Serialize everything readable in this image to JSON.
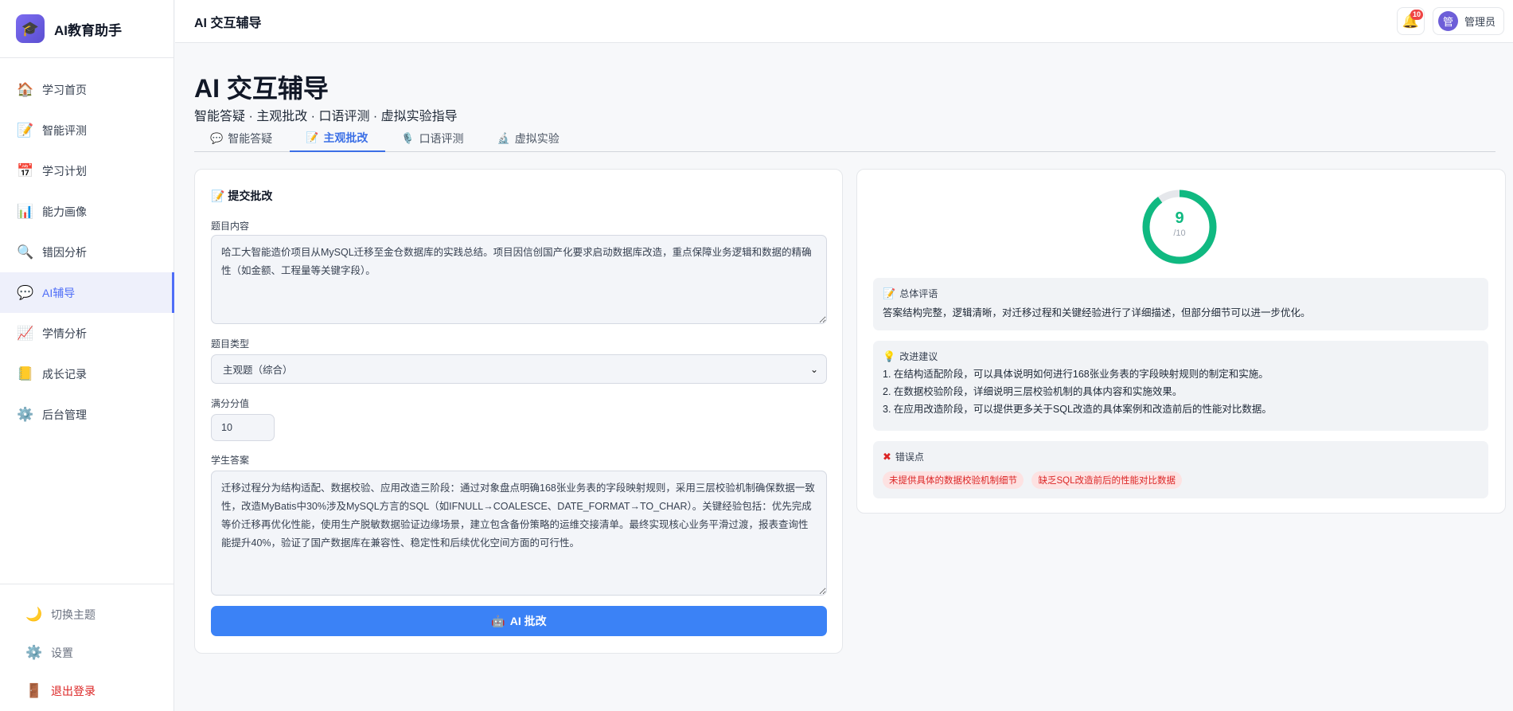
{
  "brand": {
    "name": "AI教育助手"
  },
  "sidebar": {
    "items": [
      {
        "label": "学习首页",
        "icon": "🏠"
      },
      {
        "label": "智能评测",
        "icon": "📝"
      },
      {
        "label": "学习计划",
        "icon": "📅"
      },
      {
        "label": "能力画像",
        "icon": "📊"
      },
      {
        "label": "错因分析",
        "icon": "🔍"
      },
      {
        "label": "AI辅导",
        "icon": "💬"
      },
      {
        "label": "学情分析",
        "icon": "📈"
      },
      {
        "label": "成长记录",
        "icon": "📒"
      },
      {
        "label": "后台管理",
        "icon": "⚙️"
      }
    ],
    "bottom": [
      {
        "label": "切换主题",
        "icon": "🌙"
      },
      {
        "label": "设置",
        "icon": "⚙️"
      },
      {
        "label": "退出登录",
        "icon": "🚪"
      }
    ]
  },
  "topbar": {
    "title": "AI 交互辅导",
    "notification_count": "10",
    "avatar_text": "管",
    "user_name": "管理员"
  },
  "header": {
    "title": "AI 交互辅导",
    "subtitle": "智能答疑 · 主观批改 · 口语评测 · 虚拟实验指导"
  },
  "tabs": [
    {
      "label": "智能答疑",
      "icon": "💬"
    },
    {
      "label": "主观批改",
      "icon": "📝"
    },
    {
      "label": "口语评测",
      "icon": "🎙️"
    },
    {
      "label": "虚拟实验",
      "icon": "🔬"
    }
  ],
  "form": {
    "title": "提交批改",
    "question_label": "题目内容",
    "question_value": "哈工大智能造价项目从MySQL迁移至金仓数据库的实践总结。项目因信创国产化要求启动数据库改造，重点保障业务逻辑和数据的精确性（如金额、工程量等关键字段）。",
    "type_label": "题目类型",
    "type_value": "主观题（综合）",
    "score_label": "满分分值",
    "score_value": "10",
    "answer_label": "学生答案",
    "answer_value": "迁移过程分为结构适配、数据校验、应用改造三阶段：通过对象盘点明确168张业务表的字段映射规则，采用三层校验机制确保数据一致性，改造MyBatis中30%涉及MySQL方言的SQL（如IFNULL→COALESCE、DATE_FORMAT→TO_CHAR）。关键经验包括：优先完成等价迁移再优化性能，使用生产脱敏数据验证边缘场景，建立包含备份策略的运维交接清单。最终实现核心业务平滑过渡，报表查询性能提升40%，验证了国产数据库在兼容性、稳定性和后续优化空间方面的可行性。",
    "submit_label": "AI 批改"
  },
  "result": {
    "score": 9,
    "max": 10,
    "max_label": "/10",
    "accent": "#10b981",
    "summary_title": "总体评语",
    "summary_text": "答案结构完整，逻辑清晰，对迁移过程和关键经验进行了详细描述，但部分细节可以进一步优化。",
    "suggest_title": "改进建议",
    "suggestions": [
      "1. 在结构适配阶段，可以具体说明如何进行168张业务表的字段映射规则的制定和实施。",
      "2. 在数据校验阶段，详细说明三层校验机制的具体内容和实施效果。",
      "3. 在应用改造阶段，可以提供更多关于SQL改造的具体案例和改造前后的性能对比数据。"
    ],
    "errors_title": "错误点",
    "errors": [
      "未提供具体的数据校验机制细节",
      "缺乏SQL改造前后的性能对比数据"
    ]
  }
}
